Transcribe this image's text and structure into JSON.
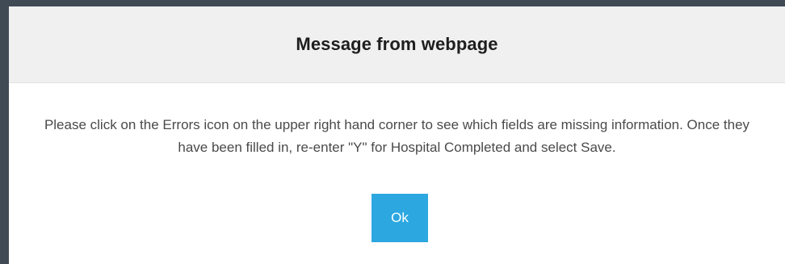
{
  "dialog": {
    "title": "Message from webpage",
    "message": "Please click on the Errors icon on the upper right hand corner to see which fields are missing information. Once they have been filled in, re-enter \"Y\" for Hospital Completed and select Save.",
    "ok_label": "Ok"
  },
  "colors": {
    "header_bg": "#f0f0f0",
    "button_bg": "#2ca7e0",
    "backdrop": "#3f4a55"
  }
}
